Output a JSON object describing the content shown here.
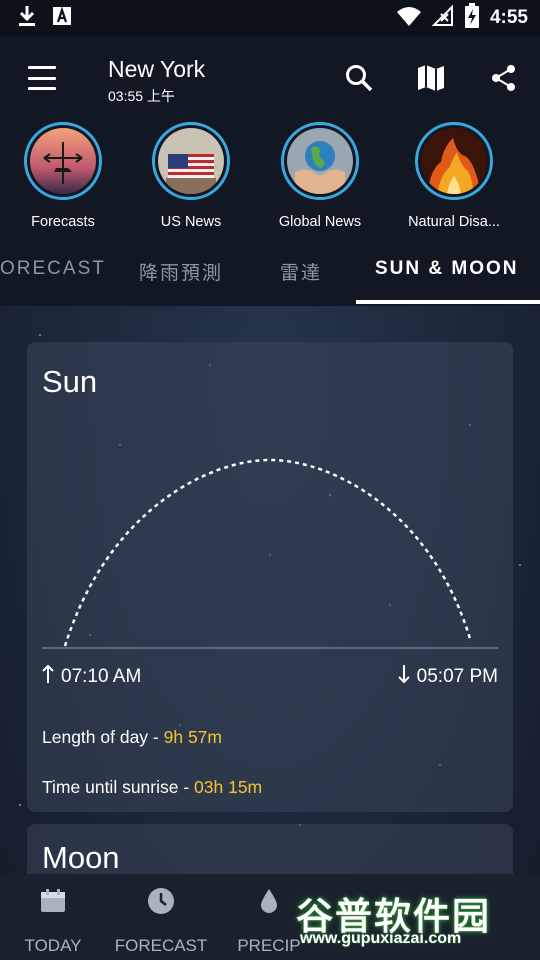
{
  "status_bar": {
    "time": "4:55",
    "icons": [
      "download-icon",
      "font-a-icon",
      "wifi-icon",
      "no-signal-icon",
      "battery-charging-icon"
    ]
  },
  "header": {
    "city": "New York",
    "local_time": "03:55 上午",
    "icons": [
      "menu-icon",
      "search-icon",
      "map-icon",
      "share-icon"
    ]
  },
  "stories": [
    {
      "label": "Forecasts"
    },
    {
      "label": "US News"
    },
    {
      "label": "Global News"
    },
    {
      "label": "Natural Disa..."
    }
  ],
  "tabs": {
    "items": [
      {
        "label": "ORECAST"
      },
      {
        "label": "降雨預測"
      },
      {
        "label": "雷達"
      },
      {
        "label": "SUN & MOON"
      }
    ],
    "active_index": 3
  },
  "sun_card": {
    "title": "Sun",
    "sunrise": "07:10 AM",
    "sunset": "05:07 PM",
    "length_label": "Length of day - ",
    "length_value": "9h 57m",
    "until_label": "Time until sunrise - ",
    "until_value": "03h 15m"
  },
  "moon_card": {
    "title": "Moon"
  },
  "bottom_nav": [
    {
      "label": "TODAY",
      "icon": "calendar-icon"
    },
    {
      "label": "FORECAST",
      "icon": "clock-icon"
    },
    {
      "label": "PRECIP",
      "icon": "drop-icon"
    }
  ],
  "watermark": {
    "text": "谷普软件园",
    "url": "www.gupuxiazai.com"
  },
  "colors": {
    "accent_ring": "#3aa8e0",
    "highlight_value": "#f4c430",
    "app_bar": "#111823",
    "card": "#3a465a"
  }
}
